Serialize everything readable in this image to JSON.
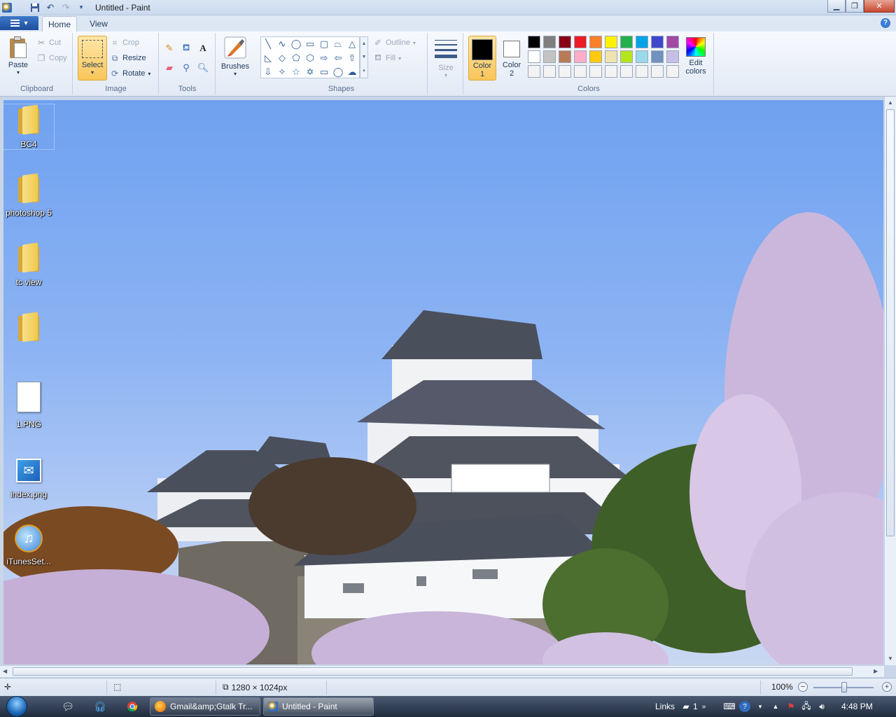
{
  "window": {
    "title": "Untitled - Paint"
  },
  "tabs": [
    {
      "label": "Home"
    },
    {
      "label": "View"
    }
  ],
  "ribbon": {
    "clipboard": {
      "label": "Clipboard",
      "paste": "Paste",
      "cut": "Cut",
      "copy": "Copy"
    },
    "image": {
      "label": "Image",
      "select": "Select",
      "crop": "Crop",
      "resize": "Resize",
      "rotate": "Rotate"
    },
    "tools": {
      "label": "Tools"
    },
    "brushes": {
      "label": "Brushes"
    },
    "shapes": {
      "label": "Shapes",
      "outline": "Outline",
      "fill": "Fill"
    },
    "size": {
      "label": "Size"
    },
    "colors": {
      "label": "Colors",
      "color1_line1": "Color",
      "color1_line2": "1",
      "color2_line1": "Color",
      "color2_line2": "2",
      "edit_line1": "Edit",
      "edit_line2": "colors",
      "color1_value": "#000000",
      "color2_value": "#ffffff",
      "palette": [
        "#000000",
        "#7f7f7f",
        "#880015",
        "#ed1c24",
        "#ff7f27",
        "#fff200",
        "#22b14c",
        "#00a2e8",
        "#3f48cc",
        "#a349a4",
        "#ffffff",
        "#c3c3c3",
        "#b97a57",
        "#ffaec9",
        "#ffc90e",
        "#efe4b0",
        "#b5e61d",
        "#99d9ea",
        "#7092be",
        "#c8bfe7",
        "#f3f3f3",
        "#f3f3f3",
        "#f3f3f3",
        "#f3f3f3",
        "#f3f3f3",
        "#f3f3f3",
        "#f3f3f3",
        "#f3f3f3",
        "#f3f3f3",
        "#f3f3f3"
      ]
    }
  },
  "desktop_icons": [
    {
      "label": "BC4",
      "icon": "folder-icon"
    },
    {
      "label": "photoshop 5",
      "icon": "folder-icon"
    },
    {
      "label": "tc view",
      "icon": "folder-icon"
    },
    {
      "label": "",
      "icon": "folder-icon"
    },
    {
      "label": "1.PNG",
      "icon": "document-icon"
    },
    {
      "label": "index.png",
      "icon": "image-file-icon"
    },
    {
      "label": "iTunesSet...",
      "icon": "itunes-icon"
    }
  ],
  "status": {
    "dimensions": "1280 × 1024px",
    "zoom": "100%"
  },
  "taskbar": {
    "buttons": [
      {
        "label": "Gmail&amp;Gtalk Tr..."
      },
      {
        "label": "Untitled - Paint"
      }
    ],
    "links_label": "Links",
    "links_count": "1",
    "time": "4:48 PM"
  }
}
